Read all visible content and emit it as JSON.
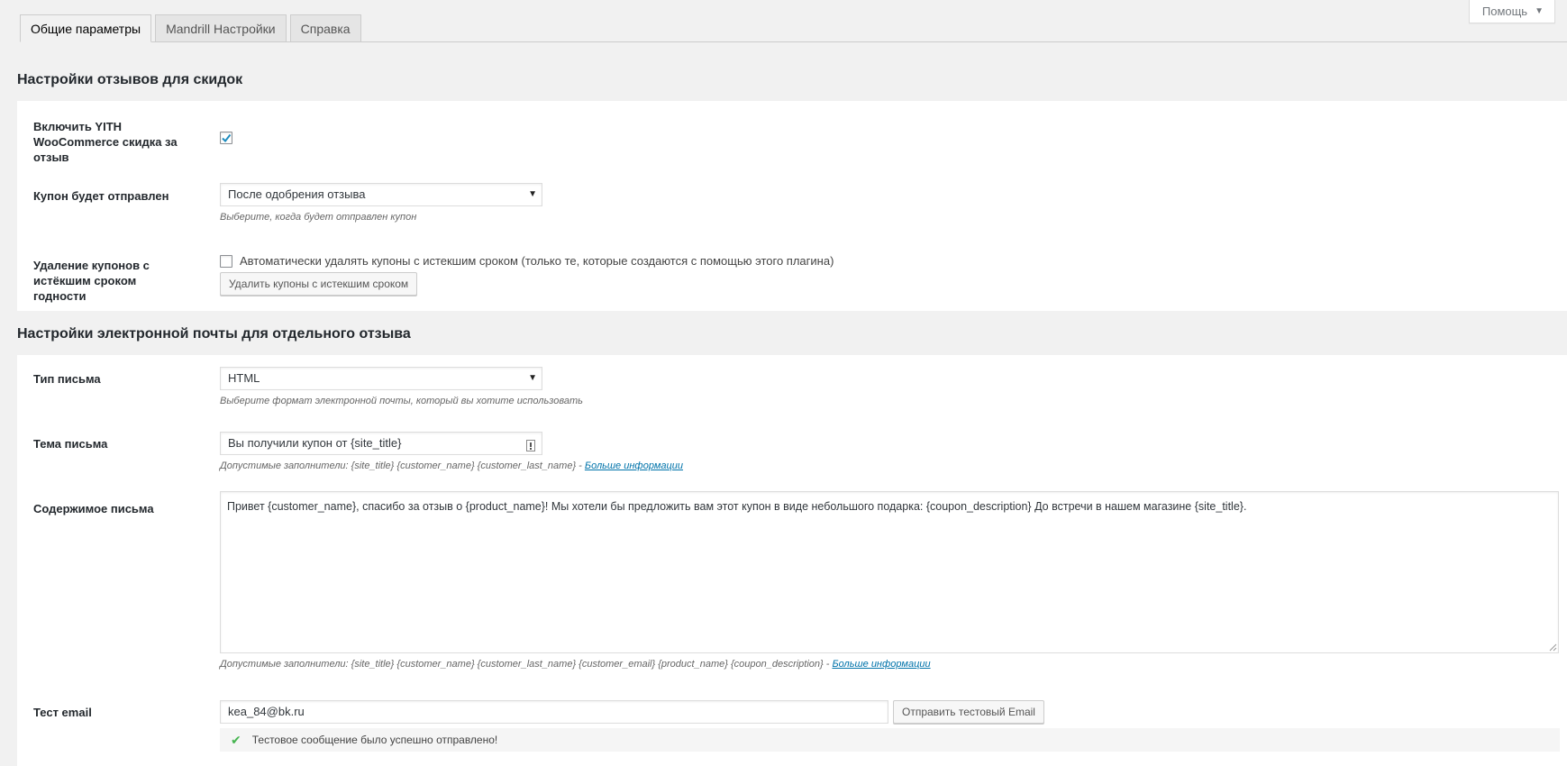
{
  "help_tab": {
    "label": "Помощь"
  },
  "tabs": [
    {
      "label": "Общие параметры",
      "active": true
    },
    {
      "label": "Mandrill Настройки",
      "active": false
    },
    {
      "label": "Справка",
      "active": false
    }
  ],
  "section1": {
    "title": "Настройки отзывов для скидок",
    "enable": {
      "label": "Включить YITH WooCommerce скидка за отзыв",
      "checked": true
    },
    "coupon_sent": {
      "label": "Купон будет отправлен",
      "value": "После одобрения отзыва",
      "description": "Выберите, когда будет отправлен купон"
    },
    "delete_expired": {
      "label": "Удаление купонов с истёкшим сроком годности",
      "checkbox_label": "Автоматически удалять купоны с истекшим сроком (только те, которые создаются с помощью этого плагина)",
      "checked": false,
      "button_label": "Удалить купоны с истекшим сроком"
    }
  },
  "section2": {
    "title": "Настройки электронной почты для отдельного отзыва",
    "mail_type": {
      "label": "Тип письма",
      "value": "HTML",
      "description": "Выберите формат электронной почты, который вы хотите использовать"
    },
    "subject": {
      "label": "Тема письма",
      "value": "Вы получили купон от {site_title}",
      "description": "Допустимые заполнители: {site_title} {customer_name} {customer_last_name} - ",
      "more_link": "Больше информации"
    },
    "content": {
      "label": "Содержимое письма",
      "value": "Привет {customer_name}, спасибо за отзыв о {product_name}! Мы хотели бы предложить вам этот купон в виде небольшого подарка: {coupon_description} До встречи в нашем магазине {site_title}.",
      "description": "Допустимые заполнители: {site_title} {customer_name} {customer_last_name} {customer_email} {product_name} {coupon_description} - ",
      "more_link": "Больше информации"
    },
    "test_email": {
      "label": "Тест email",
      "value": "kea_84@bk.ru",
      "button_label": "Отправить тестовый Email",
      "success_message": "Тестовое сообщение было успешно отправлено!"
    }
  }
}
